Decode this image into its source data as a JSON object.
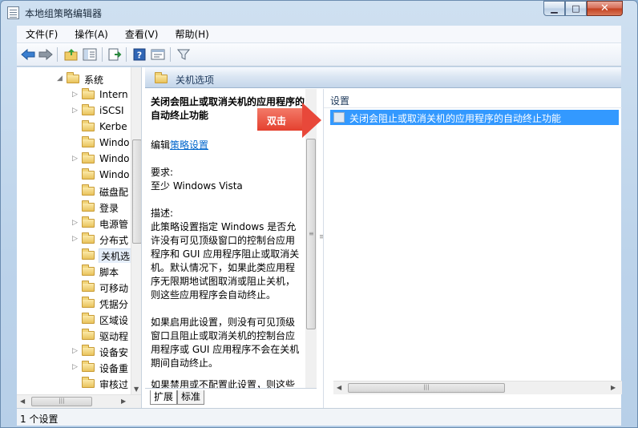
{
  "window": {
    "title": "本地组策略编辑器",
    "minimize_glyph": "▁",
    "maximize_glyph": "□",
    "close_glyph": "✕"
  },
  "menu": [
    {
      "label": "文件(F)"
    },
    {
      "label": "操作(A)"
    },
    {
      "label": "查看(V)"
    },
    {
      "label": "帮助(H)"
    }
  ],
  "toolbar": [
    "back-arrow-icon",
    "forward-arrow-icon",
    "up-folder-icon",
    "show-hide-tree-icon",
    "export-list-icon",
    "help-icon",
    "properties-icon",
    "filter-icon"
  ],
  "tree": {
    "items": [
      {
        "label": "系统",
        "expander": "◢",
        "level": 0
      },
      {
        "label": "Intern",
        "expander": "▷",
        "level": 1
      },
      {
        "label": "iSCSI",
        "expander": "▷",
        "level": 1
      },
      {
        "label": "Kerbe",
        "expander": "",
        "level": 1
      },
      {
        "label": "Windo",
        "expander": "",
        "level": 1
      },
      {
        "label": "Windo",
        "expander": "▷",
        "level": 1
      },
      {
        "label": "Windo",
        "expander": "",
        "level": 1
      },
      {
        "label": "磁盘配",
        "expander": "",
        "level": 1
      },
      {
        "label": "登录",
        "expander": "",
        "level": 1
      },
      {
        "label": "电源管",
        "expander": "▷",
        "level": 1
      },
      {
        "label": "分布式",
        "expander": "▷",
        "level": 1
      },
      {
        "label": "关机选",
        "expander": "",
        "level": 1,
        "selected": true
      },
      {
        "label": "脚本",
        "expander": "",
        "level": 1
      },
      {
        "label": "可移动",
        "expander": "",
        "level": 1
      },
      {
        "label": "凭据分",
        "expander": "",
        "level": 1
      },
      {
        "label": "区域设",
        "expander": "",
        "level": 1
      },
      {
        "label": "驱动程",
        "expander": "",
        "level": 1
      },
      {
        "label": "设备安",
        "expander": "▷",
        "level": 1
      },
      {
        "label": "设备重",
        "expander": "▷",
        "level": 1
      },
      {
        "label": "审核过",
        "expander": "",
        "level": 1
      }
    ]
  },
  "header": {
    "title": "关机选项"
  },
  "description": {
    "title": "关闭会阻止或取消关机的应用程序的自动终止功能",
    "edit_prefix": "编辑",
    "edit_link": "策略设置",
    "requirements_label": "要求:",
    "requirements_value": "至少 Windows Vista",
    "desc_label": "描述:",
    "desc_para1": "此策略设置指定 Windows 是否允许没有可见顶级窗口的控制台应用程序和 GUI 应用程序阻止或取消关机。默认情况下，如果此类应用程序无限期地试图取消或阻止关机，则这些应用程序会自动终止。",
    "desc_para2": "如果启用此设置，则没有可见顶级窗口且阻止或取消关机的控制台应用程序或 GUI 应用程序不会在关机期间自动终止。",
    "desc_para3": "如果禁用或不配置此设置，则这些"
  },
  "tabs": [
    {
      "label": "扩展"
    },
    {
      "label": "标准"
    }
  ],
  "settings": {
    "column_header": "设置",
    "rows": [
      {
        "label": "关闭会阻止或取消关机的应用程序的自动终止功能",
        "selected": true
      }
    ]
  },
  "callout": {
    "text": "双击",
    "color": "#e8483a"
  },
  "status": {
    "text": "1 个设置"
  },
  "colors": {
    "selection": "#3399ff",
    "link": "#0066cc",
    "header_text": "#1e395b"
  }
}
